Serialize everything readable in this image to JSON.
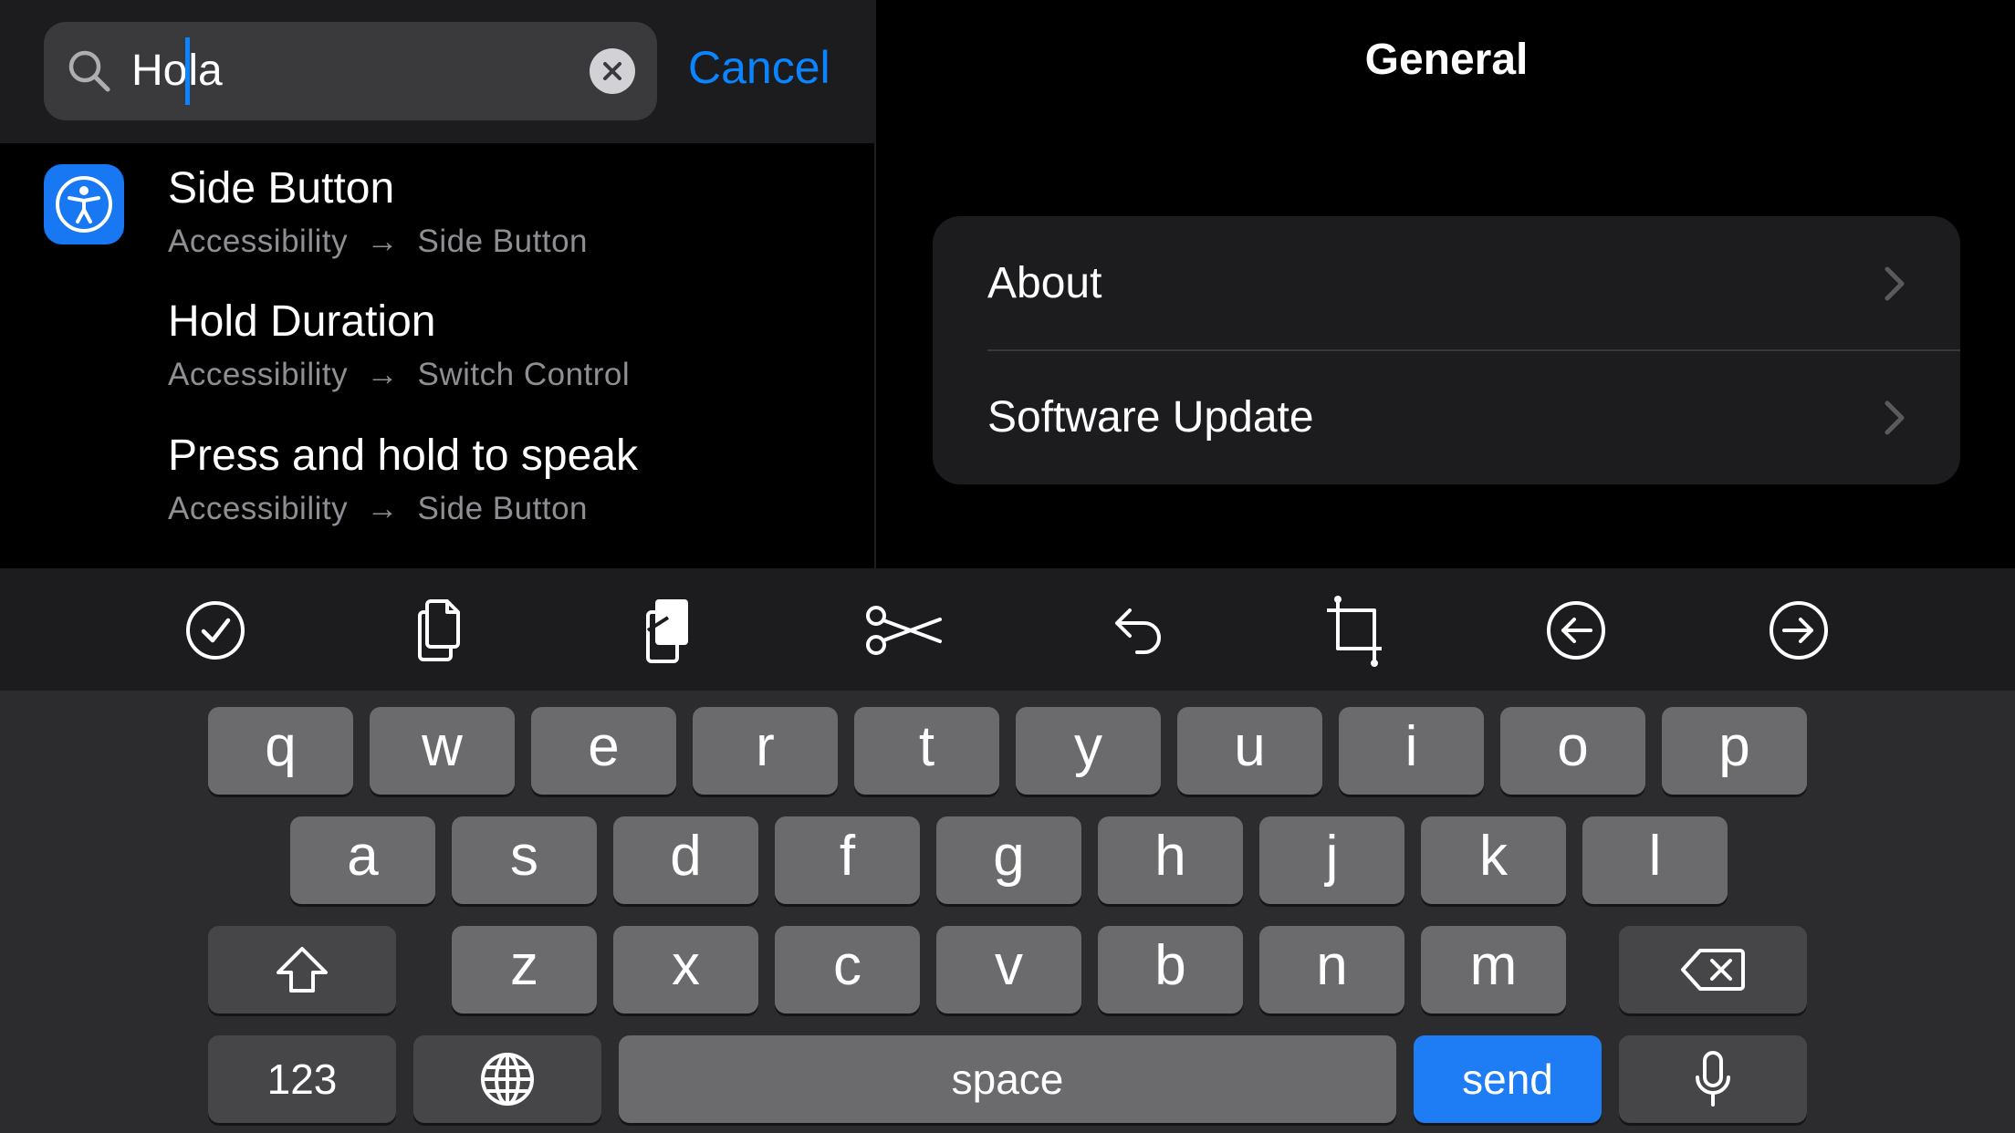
{
  "search": {
    "text_before_caret": "Ho",
    "text_after_caret": "la",
    "cancel_label": "Cancel"
  },
  "results": [
    {
      "title": "Side Button",
      "path_root": "Accessibility",
      "path_leaf": "Side Button",
      "icon": "accessibility-icon"
    },
    {
      "title": "Hold Duration",
      "path_root": "Accessibility",
      "path_leaf": "Switch Control"
    },
    {
      "title": "Press and hold to speak",
      "path_root": "Accessibility",
      "path_leaf": "Side Button"
    }
  ],
  "detail": {
    "title": "General",
    "rows": [
      {
        "label": "About"
      },
      {
        "label": "Software Update"
      }
    ]
  },
  "toolbar": {
    "items": [
      "select-all-icon",
      "copy-icon",
      "paste-icon",
      "cut-icon",
      "undo-icon",
      "crop-icon",
      "move-left-icon",
      "move-right-icon"
    ]
  },
  "keyboard": {
    "row1": [
      "q",
      "w",
      "e",
      "r",
      "t",
      "y",
      "u",
      "i",
      "o",
      "p"
    ],
    "row2": [
      "a",
      "s",
      "d",
      "f",
      "g",
      "h",
      "j",
      "k",
      "l"
    ],
    "row3": [
      "z",
      "x",
      "c",
      "v",
      "b",
      "n",
      "m"
    ],
    "numbers_label": "123",
    "space_label": "space",
    "send_label": "send"
  },
  "colors": {
    "accent": "#0a84ff",
    "send_key": "#1e7cf5",
    "app_icon": "#1877f2"
  }
}
